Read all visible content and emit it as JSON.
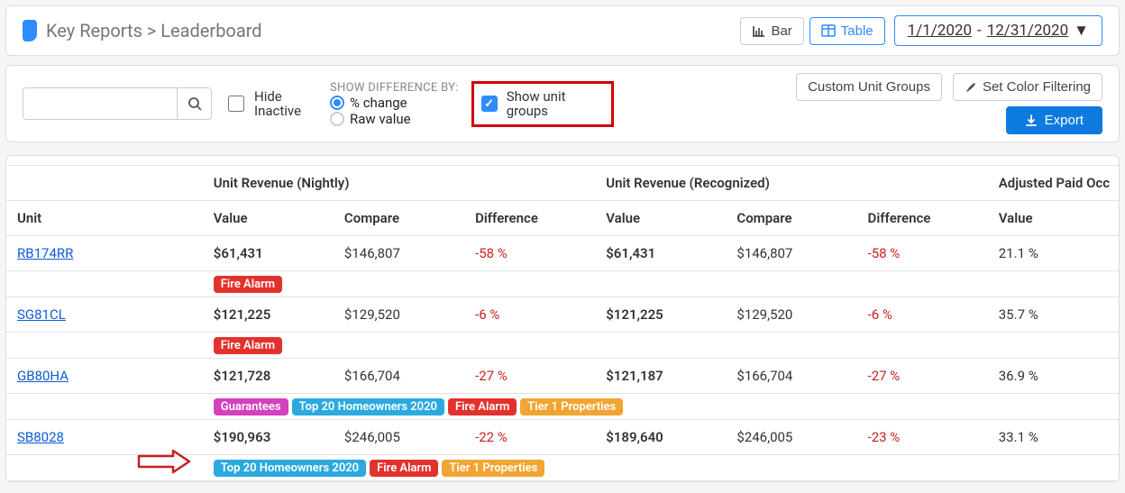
{
  "breadcrumb": {
    "text": "Key Reports > Leaderboard"
  },
  "view": {
    "bar": "Bar",
    "table": "Table"
  },
  "dateRange": {
    "start": "1/1/2020",
    "end": "12/31/2020"
  },
  "filters": {
    "hideInactive": "Hide Inactive",
    "diffLabel": "SHOW DIFFERENCE BY:",
    "pctChange": "% change",
    "rawValue": "Raw value",
    "showUnitGroups": "Show unit groups",
    "customUnitGroups": "Custom Unit Groups",
    "setColorFiltering": "Set Color Filtering",
    "export": "Export"
  },
  "table": {
    "groupHeaders": {
      "unitRevNightly": "Unit Revenue (Nightly)",
      "unitRevRecognized": "Unit Revenue (Recognized)",
      "adjPaidOcc": "Adjusted Paid Occ"
    },
    "cols": {
      "unit": "Unit",
      "value": "Value",
      "compare": "Compare",
      "difference": "Difference"
    },
    "rows": [
      {
        "unit": "RB174RR",
        "nightly": {
          "value": "$61,431",
          "compare": "$146,807",
          "diff": "-58 %"
        },
        "recognized": {
          "value": "$61,431",
          "compare": "$146,807",
          "diff": "-58 %"
        },
        "occ": "21.1 %",
        "tags": [
          {
            "cls": "fire",
            "text": "Fire Alarm"
          }
        ]
      },
      {
        "unit": "SG81CL",
        "nightly": {
          "value": "$121,225",
          "compare": "$129,520",
          "diff": "-6 %"
        },
        "recognized": {
          "value": "$121,225",
          "compare": "$129,520",
          "diff": "-6 %"
        },
        "occ": "35.7 %",
        "tags": [
          {
            "cls": "fire",
            "text": "Fire Alarm"
          }
        ]
      },
      {
        "unit": "GB80HA",
        "nightly": {
          "value": "$121,728",
          "compare": "$166,704",
          "diff": "-27 %"
        },
        "recognized": {
          "value": "$121,187",
          "compare": "$166,704",
          "diff": "-27 %"
        },
        "occ": "36.9 %",
        "tags": [
          {
            "cls": "guar",
            "text": "Guarantees"
          },
          {
            "cls": "top20",
            "text": "Top 20 Homeowners 2020"
          },
          {
            "cls": "fire",
            "text": "Fire Alarm"
          },
          {
            "cls": "tier1",
            "text": "Tier 1 Properties"
          }
        ]
      },
      {
        "unit": "SB8028",
        "nightly": {
          "value": "$190,963",
          "compare": "$246,005",
          "diff": "-22 %"
        },
        "recognized": {
          "value": "$189,640",
          "compare": "$246,005",
          "diff": "-23 %"
        },
        "occ": "33.1 %",
        "tags": [
          {
            "cls": "top20",
            "text": "Top 20 Homeowners 2020"
          },
          {
            "cls": "fire",
            "text": "Fire Alarm"
          },
          {
            "cls": "tier1",
            "text": "Tier 1 Properties"
          }
        ]
      }
    ]
  }
}
